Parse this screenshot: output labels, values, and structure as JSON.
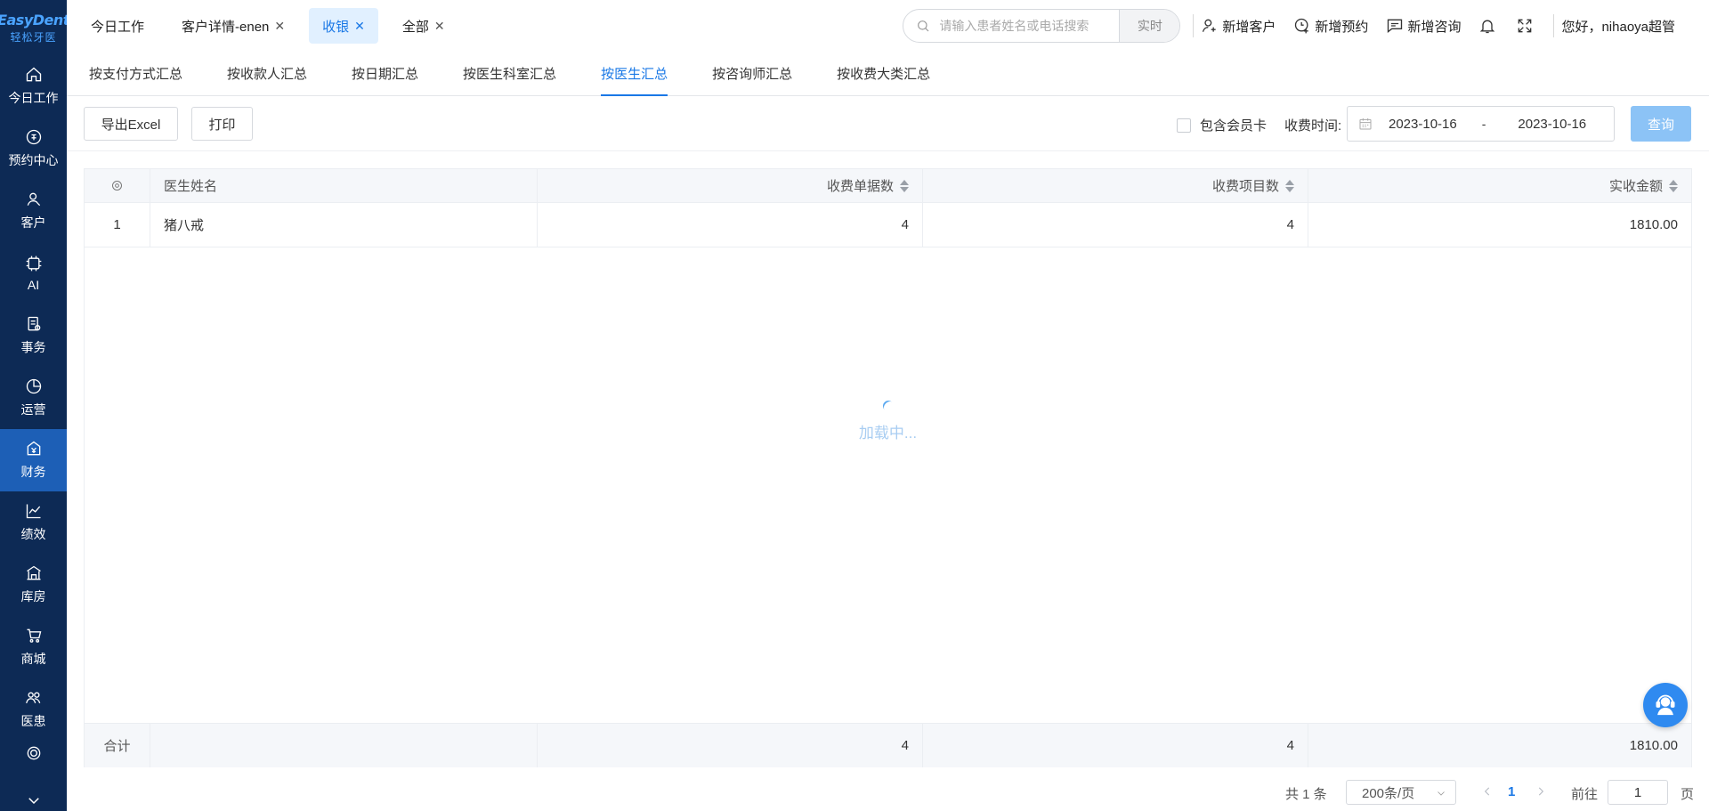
{
  "logo": {
    "brand": "EasyDent",
    "cn": "轻松牙医"
  },
  "sidebar": {
    "items": [
      {
        "label": "今日工作",
        "icon": "home-icon"
      },
      {
        "label": "预约中心",
        "icon": "calendar-badge-icon"
      },
      {
        "label": "客户",
        "icon": "user-icon"
      },
      {
        "label": "AI",
        "icon": "ai-chip-icon"
      },
      {
        "label": "事务",
        "icon": "task-icon"
      },
      {
        "label": "运营",
        "icon": "pie-chart-icon"
      },
      {
        "label": "财务",
        "icon": "finance-icon",
        "active": true
      },
      {
        "label": "绩效",
        "icon": "line-chart-icon"
      },
      {
        "label": "库房",
        "icon": "warehouse-icon"
      },
      {
        "label": "商城",
        "icon": "cart-icon"
      },
      {
        "label": "医患",
        "icon": "doctor-patient-icon"
      }
    ]
  },
  "tabs": [
    {
      "label": "今日工作",
      "closable": false
    },
    {
      "label": "客户详情-enen",
      "closable": true
    },
    {
      "label": "收银",
      "closable": true,
      "active": true
    },
    {
      "label": "全部",
      "closable": true
    }
  ],
  "header": {
    "search_placeholder": "请输入患者姓名或电话搜索",
    "search_mode": "实时",
    "new_customer": "新增客户",
    "new_appointment": "新增预约",
    "new_consult": "新增咨询",
    "greeting": "您好，nihaoya超管"
  },
  "subtabs": [
    {
      "label": "按支付方式汇总"
    },
    {
      "label": "按收款人汇总"
    },
    {
      "label": "按日期汇总"
    },
    {
      "label": "按医生科室汇总"
    },
    {
      "label": "按医生汇总",
      "active": true
    },
    {
      "label": "按咨询师汇总"
    },
    {
      "label": "按收费大类汇总"
    }
  ],
  "toolbar": {
    "export": "导出Excel",
    "print": "打印",
    "include_member": "包含会员卡",
    "time_label": "收费时间:",
    "date_from": "2023-10-16",
    "date_to": "2023-10-16",
    "separator": "-",
    "query": "查询"
  },
  "table": {
    "columns": [
      "医生姓名",
      "收费单据数",
      "收费项目数",
      "实收金额"
    ],
    "rows": [
      {
        "index": "1",
        "doctor": "猪八戒",
        "receipts": "4",
        "items": "4",
        "amount": "1810.00"
      }
    ],
    "footer": {
      "label": "合计",
      "receipts": "4",
      "items": "4",
      "amount": "1810.00"
    },
    "loading": "加载中..."
  },
  "pagination": {
    "total": "共 1 条",
    "page_size": "200条/页",
    "current": "1",
    "goto_label": "前往",
    "goto_value": "1",
    "page_unit": "页"
  },
  "colors": {
    "sidebar_bg": "#0d2a55",
    "sidebar_active": "#1d5fb6",
    "accent": "#1a78e6",
    "query_btn": "#8cc3f6"
  }
}
